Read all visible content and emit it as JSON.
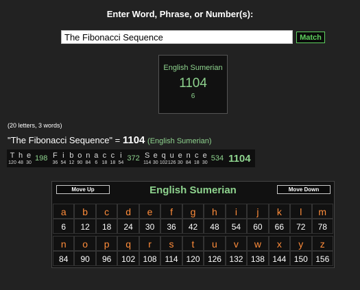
{
  "prompt": "Enter Word, Phrase, or Number(s):",
  "input": {
    "value": "The Fibonacci Sequence"
  },
  "match_button": "Match",
  "result_card": {
    "cipher": "English Sumerian",
    "value": "1104",
    "words": "6"
  },
  "meta": "(20 letters, 3 words)",
  "phrase": {
    "open": "\"The Fibonacci Sequence\" = ",
    "value": "1104",
    "cipher": "(English Sumerian)"
  },
  "breakdown": {
    "words": [
      {
        "chars": [
          "T",
          "h",
          "e"
        ],
        "values": [
          "120",
          "48",
          "30"
        ],
        "sum": "198"
      },
      {
        "chars": [
          "F",
          "i",
          "b",
          "o",
          "n",
          "a",
          "c",
          "c",
          "i"
        ],
        "values": [
          "36",
          "54",
          "12",
          "90",
          "84",
          "6",
          "18",
          "18",
          "54"
        ],
        "sum": "372"
      },
      {
        "chars": [
          "S",
          "e",
          "q",
          "u",
          "e",
          "n",
          "c",
          "e"
        ],
        "values": [
          "114",
          "30",
          "102",
          "126",
          "30",
          "84",
          "18",
          "30"
        ],
        "sum": "534"
      }
    ],
    "total": "1104"
  },
  "cipher_chart": {
    "move_up": "Move Up",
    "title": "English Sumerian",
    "move_down": "Move Down",
    "row1_letters": [
      "a",
      "b",
      "c",
      "d",
      "e",
      "f",
      "g",
      "h",
      "i",
      "j",
      "k",
      "l",
      "m"
    ],
    "row1_values": [
      "6",
      "12",
      "18",
      "24",
      "30",
      "36",
      "42",
      "48",
      "54",
      "60",
      "66",
      "72",
      "78"
    ],
    "row2_letters": [
      "n",
      "o",
      "p",
      "q",
      "r",
      "s",
      "t",
      "u",
      "v",
      "w",
      "x",
      "y",
      "z"
    ],
    "row2_values": [
      "84",
      "90",
      "96",
      "102",
      "108",
      "114",
      "120",
      "126",
      "132",
      "138",
      "144",
      "150",
      "156"
    ]
  },
  "colors": {
    "accent_green": "#8ed38e",
    "letter_orange": "#ff8c3a",
    "background": "#222222"
  }
}
